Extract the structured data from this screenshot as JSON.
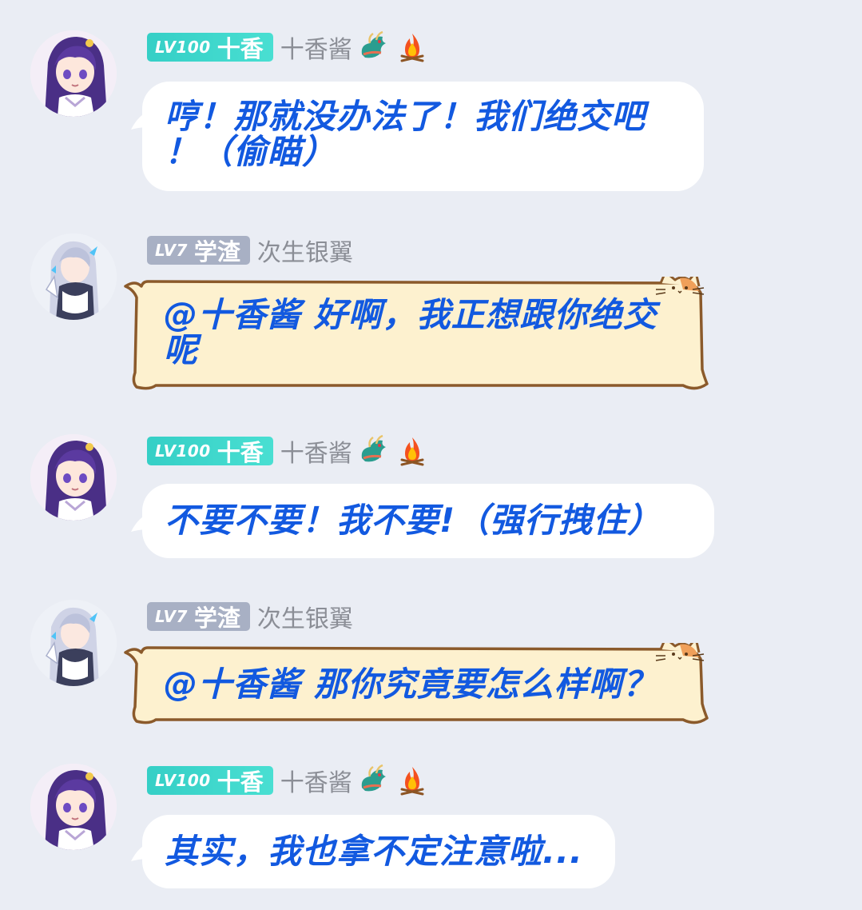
{
  "messages": [
    {
      "sender": {
        "level": "LV100",
        "title": "十香",
        "name": "十香酱",
        "badge_color": "#3cd6cb"
      },
      "emojis": [
        "dragon-icon",
        "fire-icon"
      ],
      "text_lines": [
        "哼！那就没办法了！我们绝交吧",
        "！（偷瞄）"
      ],
      "bubble_style": "plain"
    },
    {
      "sender": {
        "level": "LV7",
        "title": "学渣",
        "name": "次生银翼",
        "badge_color": "#a8b0c4"
      },
      "emojis": [],
      "text_lines": [
        "@十香酱 好啊，我正想跟你绝交",
        "呢"
      ],
      "bubble_style": "cat"
    },
    {
      "sender": {
        "level": "LV100",
        "title": "十香",
        "name": "十香酱",
        "badge_color": "#3cd6cb"
      },
      "emojis": [
        "dragon-icon",
        "fire-icon"
      ],
      "text_lines": [
        "不要不要！我不要!（强行拽住）"
      ],
      "bubble_style": "plain"
    },
    {
      "sender": {
        "level": "LV7",
        "title": "学渣",
        "name": "次生银翼",
        "badge_color": "#a8b0c4"
      },
      "emojis": [],
      "text_lines": [
        "@十香酱 那你究竟要怎么样啊？"
      ],
      "bubble_style": "cat"
    },
    {
      "sender": {
        "level": "LV100",
        "title": "十香",
        "name": "十香酱",
        "badge_color": "#3cd6cb"
      },
      "emojis": [
        "dragon-icon",
        "fire-icon"
      ],
      "text_lines": [
        "其实，我也拿不定注意啦..."
      ],
      "bubble_style": "plain"
    }
  ],
  "colors": {
    "background": "#eaedf4",
    "message_text": "#1259e0",
    "nickname_text": "#8b8e96",
    "cat_bubble_fill": "#fdf1cf",
    "cat_bubble_border": "#8b5a2b"
  }
}
